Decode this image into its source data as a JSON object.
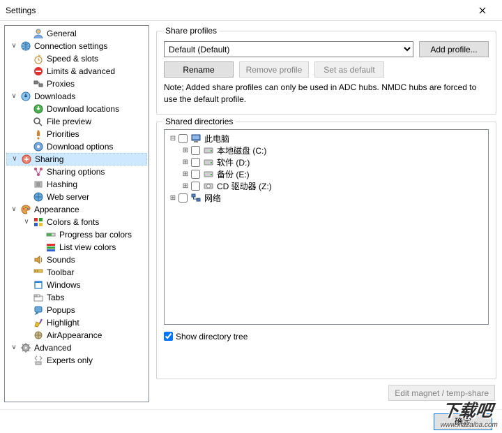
{
  "window": {
    "title": "Settings"
  },
  "tree": {
    "items": [
      {
        "depth": 1,
        "expander": "",
        "icon": "user",
        "label": "General"
      },
      {
        "depth": 0,
        "expander": "∨",
        "icon": "globe",
        "label": "Connection settings"
      },
      {
        "depth": 1,
        "expander": "",
        "icon": "clock",
        "label": "Speed & slots"
      },
      {
        "depth": 1,
        "expander": "",
        "icon": "limit",
        "label": "Limits & advanced"
      },
      {
        "depth": 1,
        "expander": "",
        "icon": "proxy",
        "label": "Proxies"
      },
      {
        "depth": 0,
        "expander": "∨",
        "icon": "download",
        "label": "Downloads"
      },
      {
        "depth": 1,
        "expander": "",
        "icon": "dlloc",
        "label": "Download locations"
      },
      {
        "depth": 1,
        "expander": "",
        "icon": "preview",
        "label": "File preview"
      },
      {
        "depth": 1,
        "expander": "",
        "icon": "prio",
        "label": "Priorities"
      },
      {
        "depth": 1,
        "expander": "",
        "icon": "dlopt",
        "label": "Download options"
      },
      {
        "depth": 0,
        "expander": "∨",
        "icon": "share",
        "label": "Sharing",
        "selected": true
      },
      {
        "depth": 1,
        "expander": "",
        "icon": "shareopt",
        "label": "Sharing options"
      },
      {
        "depth": 1,
        "expander": "",
        "icon": "hash",
        "label": "Hashing"
      },
      {
        "depth": 1,
        "expander": "",
        "icon": "web",
        "label": "Web server"
      },
      {
        "depth": 0,
        "expander": "∨",
        "icon": "palette",
        "label": "Appearance"
      },
      {
        "depth": 1,
        "expander": "∨",
        "icon": "colors",
        "label": "Colors & fonts"
      },
      {
        "depth": 2,
        "expander": "",
        "icon": "progress",
        "label": "Progress bar colors"
      },
      {
        "depth": 2,
        "expander": "",
        "icon": "listcol",
        "label": "List view colors"
      },
      {
        "depth": 1,
        "expander": "",
        "icon": "sound",
        "label": "Sounds"
      },
      {
        "depth": 1,
        "expander": "",
        "icon": "toolbar",
        "label": "Toolbar"
      },
      {
        "depth": 1,
        "expander": "",
        "icon": "windows",
        "label": "Windows"
      },
      {
        "depth": 1,
        "expander": "",
        "icon": "tabs",
        "label": "Tabs"
      },
      {
        "depth": 1,
        "expander": "",
        "icon": "popup",
        "label": "Popups"
      },
      {
        "depth": 1,
        "expander": "",
        "icon": "highlt",
        "label": "Highlight"
      },
      {
        "depth": 1,
        "expander": "",
        "icon": "airapp",
        "label": "AirAppearance"
      },
      {
        "depth": 0,
        "expander": "∨",
        "icon": "advanced",
        "label": "Advanced"
      },
      {
        "depth": 1,
        "expander": "",
        "icon": "experts",
        "label": "Experts only"
      }
    ]
  },
  "share_profiles": {
    "legend": "Share profiles",
    "dropdown": {
      "selected": "Default (Default)",
      "options": [
        "Default (Default)"
      ]
    },
    "add_label": "Add profile...",
    "rename_label": "Rename",
    "remove_label": "Remove profile",
    "default_label": "Set as default",
    "note": "Note; Added share profiles can only be used in ADC hubs. NMDC hubs are forced to use the default profile."
  },
  "shared_dirs": {
    "legend": "Shared directories",
    "nodes": [
      {
        "depth": 0,
        "exp": "⊟",
        "chk": false,
        "icon": "computer",
        "label": "此电脑"
      },
      {
        "depth": 1,
        "exp": "⊞",
        "chk": false,
        "icon": "drive",
        "label": "本地磁盘 (C:)"
      },
      {
        "depth": 1,
        "exp": "⊞",
        "chk": false,
        "icon": "drive",
        "label": "软件 (D:)"
      },
      {
        "depth": 1,
        "exp": "⊞",
        "chk": false,
        "icon": "drive",
        "label": "备份 (E:)"
      },
      {
        "depth": 1,
        "exp": "⊞",
        "chk": false,
        "icon": "cddrive",
        "label": "CD 驱动器 (Z:)"
      },
      {
        "depth": 0,
        "exp": "⊞",
        "chk": false,
        "icon": "network",
        "label": "网络"
      }
    ],
    "show_tree_label": "Show directory tree",
    "show_tree_checked": true,
    "edit_magnet_label": "Edit magnet / temp-share"
  },
  "footer": {
    "ok_label": "确定"
  },
  "watermark": {
    "brand": "下载吧",
    "url": "www.xiazaiba.com"
  }
}
